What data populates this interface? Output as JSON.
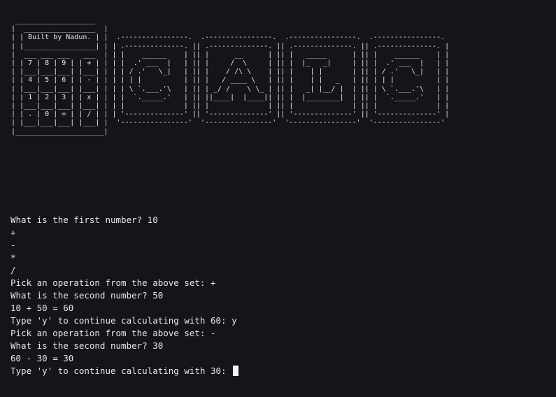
{
  "banner": {
    "ascii": " ___________________\n|  _________________  |\n| | Built by Nadun. | |  .----------------.  .----------------.  .----------------.  .----------------.\n| |_________________| | | .--------------. || .--------------. || .--------------. || .--------------. |\n|  ___ ___ ___   ___  | | |    ______    | || |      __      | || |   _____      | || |    ______    | |\n| | 7 | 8 | 9 | | + | | | |  .' ___  |   | || |     /  \\     | || |  |_   _|     | || |  .' ___  |   | |\n| |___|___|___| |___| | | | / .'   \\_|   | || |    / /\\ \\    | || |    | |       | || | / .'   \\_|   | |\n| | 4 | 5 | 6 | | - | | | | | |          | || |   / ____ \\   | || |    | |   _   | || | | |          | |\n| |___|___|___| |___| | | | \\ `.___.'\\   | || | _/ /    \\ \\_ | || |   _| |__/ |  | || | \\ `.___.'\\   | |\n| | 1 | 2 | 3 | | x | | | |  `._____.'   | || ||____|  |____|| || |  |________|  | || |  `._____.'   | |\n| |___|___|___| |___| | | |              | || |              | || |              | || |              | |\n| | . | 0 | = | | / | | | '--------------' || '--------------' || '--------------' || '--------------' |\n| |___|___|___| |___| |  '----------------'  '----------------'  '----------------'  '----------------'\n|_____________________|"
  },
  "session": {
    "lines": [
      "What is the first number? 10",
      "+",
      "-",
      "*",
      "/",
      "Pick an operation from the above set: +",
      "What is the second number? 50",
      "10 + 50 = 60",
      "Type 'y' to continue calculating with 60: y",
      "Pick an operation from the above set: -",
      "What is the second number? 30",
      "60 - 30 = 30"
    ],
    "prompt": "Type 'y' to continue calculating with 30: "
  },
  "colors": {
    "background": "#141518",
    "text": "#e8e8e8",
    "cursor": "#f2f2f2"
  }
}
